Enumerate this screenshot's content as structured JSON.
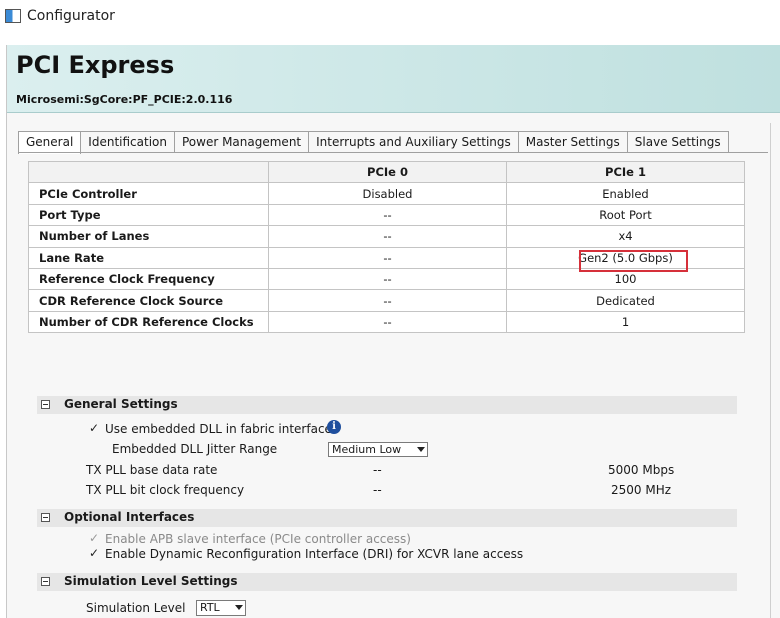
{
  "window": {
    "title": "Configurator"
  },
  "header": {
    "title": "PCI Express",
    "subtitle": "Microsemi:SgCore:PF_PCIE:2.0.116"
  },
  "tabs": [
    {
      "label": "General",
      "active": true
    },
    {
      "label": "Identification"
    },
    {
      "label": "Power Management"
    },
    {
      "label": "Interrupts and Auxiliary Settings"
    },
    {
      "label": "Master Settings"
    },
    {
      "label": "Slave Settings"
    }
  ],
  "table": {
    "columns": [
      "",
      "PCIe 0",
      "PCIe 1"
    ],
    "rows": [
      {
        "label": "PCIe Controller",
        "pcie0": "Disabled",
        "pcie1": "Enabled"
      },
      {
        "label": "Port Type",
        "pcie0": "--",
        "pcie1": "Root Port"
      },
      {
        "label": "Number of Lanes",
        "pcie0": "--",
        "pcie1": "x4"
      },
      {
        "label": "Lane Rate",
        "pcie0": "--",
        "pcie1": "Gen2 (5.0 Gbps)"
      },
      {
        "label": "Reference Clock Frequency",
        "pcie0": "--",
        "pcie1": "100"
      },
      {
        "label": "CDR Reference Clock Source",
        "pcie0": "--",
        "pcie1": "Dedicated"
      },
      {
        "label": "Number of CDR Reference Clocks",
        "pcie0": "--",
        "pcie1": "1"
      }
    ],
    "highlight_color": "#d6303a"
  },
  "general_settings": {
    "title": "General Settings",
    "use_dll_label": "Use embedded DLL in fabric interface",
    "info_icon": "i",
    "jitter_label": "Embedded DLL Jitter Range",
    "jitter_value": "Medium Low",
    "tx_pll_rate_label": "TX PLL base data rate",
    "tx_pll_rate_dash": "--",
    "tx_pll_rate_value": "5000 Mbps",
    "tx_pll_clk_label": "TX PLL bit clock frequency",
    "tx_pll_clk_dash": "--",
    "tx_pll_clk_value": "2500 MHz"
  },
  "optional_interfaces": {
    "title": "Optional Interfaces",
    "apb_label": "Enable APB slave interface (PCIe controller access)",
    "dri_label": "Enable Dynamic Reconfiguration Interface (DRI) for XCVR lane access"
  },
  "simulation": {
    "title": "Simulation Level Settings",
    "level_label": "Simulation Level",
    "level_value": "RTL"
  }
}
